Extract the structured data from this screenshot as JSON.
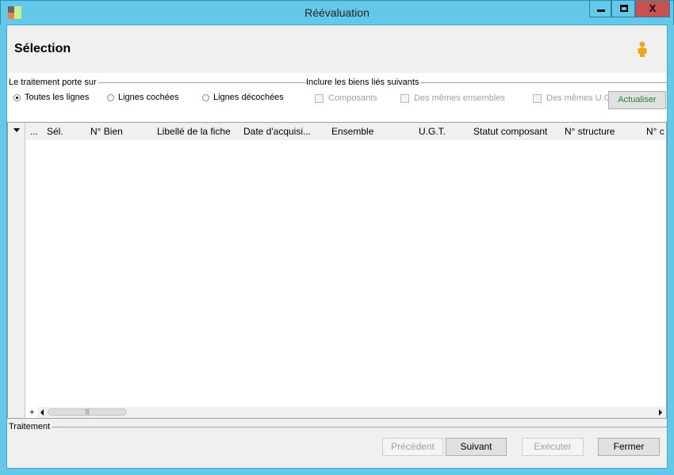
{
  "window": {
    "title": "Réévaluation"
  },
  "header": {
    "title": "Sélection",
    "user_icon": "user-icon"
  },
  "scope": {
    "legend": "Le traitement porte sur",
    "options": [
      {
        "label": "Toutes les lignes",
        "selected": true
      },
      {
        "label": "Lignes cochées",
        "selected": false
      },
      {
        "label": "Lignes décochées",
        "selected": false
      }
    ]
  },
  "linked": {
    "legend": "Inclure les biens liés suivants",
    "options": [
      {
        "label": "Composants",
        "checked": false,
        "enabled": false
      },
      {
        "label": "Des mêmes ensembles",
        "checked": false,
        "enabled": false
      },
      {
        "label": "Des mêmes U.G.T.",
        "checked": false,
        "enabled": false
      }
    ],
    "refresh_label": "Actualiser"
  },
  "grid": {
    "columns": [
      "...",
      "Sél.",
      "N° Bien",
      "Libellé de la fiche",
      "Date d'acquisi...",
      "Ensemble",
      "U.G.T.",
      "Statut composant",
      "N° structure",
      "N° c"
    ],
    "rows": [],
    "add_label": "+"
  },
  "footer": {
    "legend": "Traitement",
    "buttons": [
      {
        "label": "Précédent",
        "enabled": false
      },
      {
        "label": "Suivant",
        "enabled": true
      },
      {
        "label": "Exécuter",
        "enabled": false
      },
      {
        "label": "Fermer",
        "enabled": true
      }
    ]
  },
  "colors": {
    "titlebar": "#63c8ea",
    "close": "#c75050",
    "accent_text": "#2d7d2d"
  }
}
